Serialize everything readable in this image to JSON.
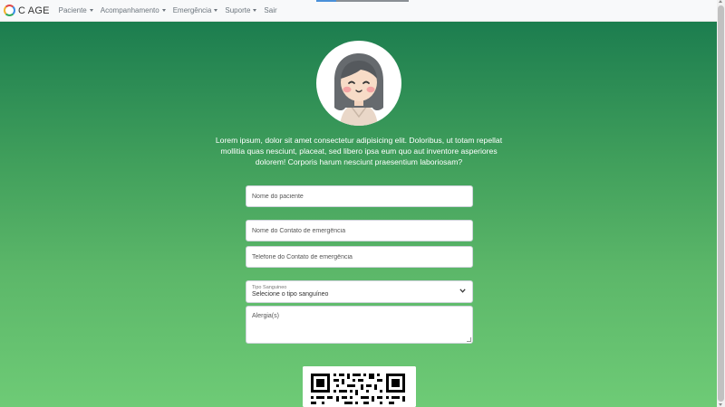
{
  "brand": {
    "name": "C AGE"
  },
  "nav": {
    "items": [
      {
        "label": "Paciente",
        "dropdown": true
      },
      {
        "label": "Acompanhamento",
        "dropdown": true
      },
      {
        "label": "Emergência",
        "dropdown": true
      },
      {
        "label": "Suporte",
        "dropdown": true
      },
      {
        "label": "Sair",
        "dropdown": false
      }
    ]
  },
  "intro": {
    "text": "Lorem ipsum, dolor sit amet consectetur adipisicing elit. Doloribus, ut totam repellat mollitia quas nesciunt, placeat, sed libero ipsa eum quo aut inventore asperiores dolorem! Corporis harum nesciunt praesentium laboriosam?"
  },
  "form": {
    "patient_name": {
      "placeholder": "Nome do paciente",
      "value": ""
    },
    "emergency_contact_name": {
      "placeholder": "Nome do Contato de emergência",
      "value": ""
    },
    "emergency_contact_phone": {
      "placeholder": "Telefone do Contato de emergência",
      "value": ""
    },
    "blood_type": {
      "label": "Tipo Sanguineo",
      "selected": "Selecione o tipo sanguíneo"
    },
    "allergies": {
      "placeholder": "Alergia(s)",
      "value": ""
    }
  },
  "icons": {
    "avatar": "female-avatar-icon",
    "caret": "caret-down-icon",
    "select": "chevron-down-icon",
    "qr": "qr-code-icon"
  },
  "colors": {
    "gradient_top": "#1c7d4f",
    "gradient_bottom": "#6ecb76",
    "navbar": "#f8f9fa"
  }
}
